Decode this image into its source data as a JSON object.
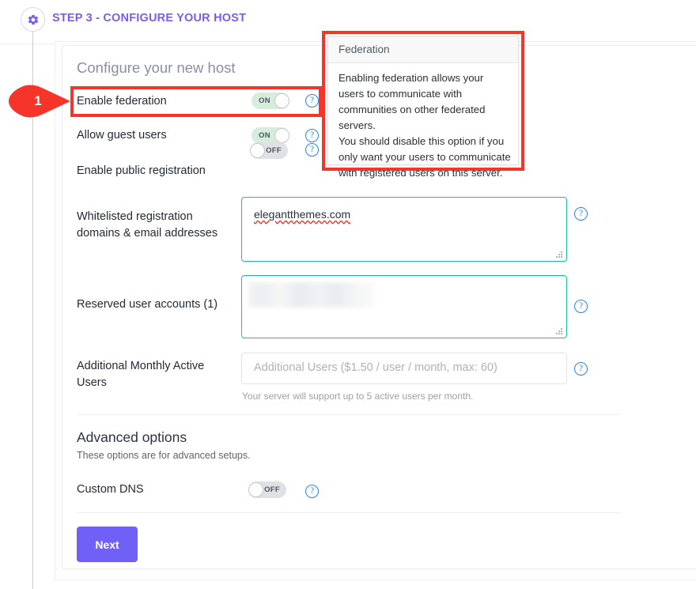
{
  "step": {
    "icon": "gear-icon",
    "title": "STEP 3 - CONFIGURE YOUR HOST",
    "accent_color": "#7b5cf0"
  },
  "card": {
    "title": "Configure your new host"
  },
  "toggles": [
    {
      "label": "Enable federation",
      "state": "ON",
      "help": "?"
    },
    {
      "label": "Allow guest users",
      "state": "ON",
      "help": "?"
    },
    {
      "label": "Enable public registration",
      "state": "OFF",
      "help": "?"
    }
  ],
  "fields": {
    "whitelist": {
      "label": "Whitelisted registration domains & email addresses",
      "value": "elegantthemes.com",
      "help": "?"
    },
    "reserved": {
      "label": "Reserved user accounts (1)",
      "value": "",
      "redacted": true,
      "help": "?"
    },
    "additional_users": {
      "label": "Additional Monthly Active Users",
      "value": "",
      "placeholder": "Additional Users ($1.50 / user / month, max: 60)",
      "helper_text": "Your server will support up to 5 active users per month.",
      "help": "?"
    }
  },
  "advanced": {
    "title": "Advanced options",
    "subtitle": "These options are for advanced setups.",
    "custom_dns": {
      "label": "Custom DNS",
      "state": "OFF",
      "help": "?"
    }
  },
  "actions": {
    "next_label": "Next",
    "next_color": "#7160f5"
  },
  "tooltip": {
    "title": "Federation",
    "line1": "Enabling federation allows your users to communicate with communities on other federated servers.",
    "line2": "You should disable this option if you only want your users to communicate with registered users on this server."
  },
  "annotation": {
    "number": "1",
    "color": "#f5352a"
  }
}
